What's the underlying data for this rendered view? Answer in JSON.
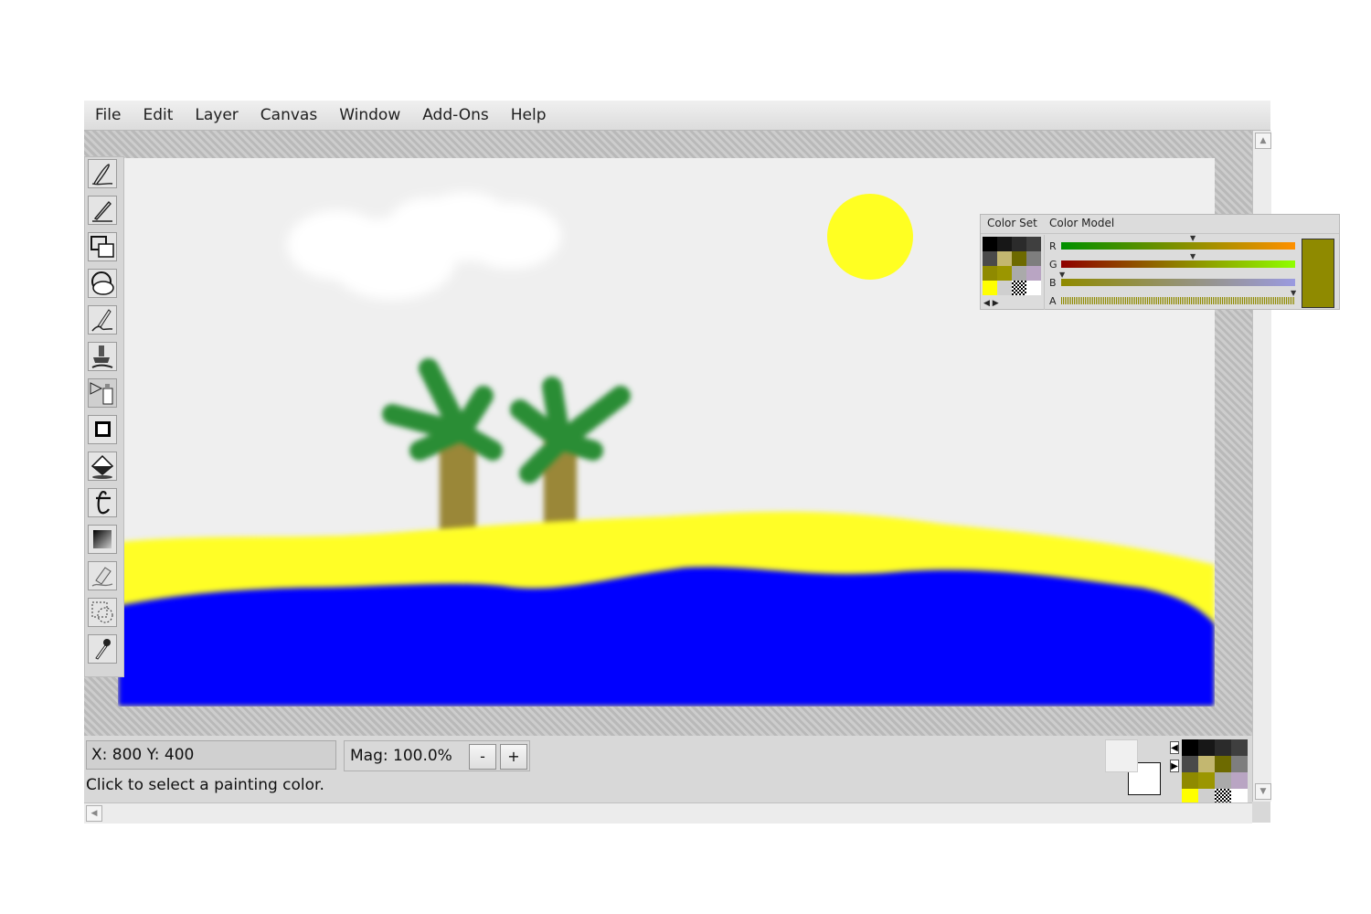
{
  "menu": [
    "File",
    "Edit",
    "Layer",
    "Canvas",
    "Window",
    "Add-Ons",
    "Help"
  ],
  "status": {
    "coords": "X: 800   Y: 400",
    "mag_label": "Mag: 100.0%",
    "zoom_out": "-",
    "zoom_in": "+",
    "hint": "Click to select a painting color."
  },
  "palette": {
    "tab_set": "Color Set",
    "tab_model": "Color Model",
    "labels": [
      "R",
      "G",
      "B",
      "A"
    ],
    "current_color": "#8f8a00",
    "swatches": [
      "#000000",
      "#171717",
      "#2b2b2b",
      "#3f3f3f",
      "#4a4a4a",
      "#c3b770",
      "#6d6a00",
      "#7e7e7e",
      "#8f8a00",
      "#9b9600",
      "#aaaaaa",
      "#b9a5c3",
      "#ffff00",
      "#cfcfcf",
      "checker",
      "#ffffff"
    ]
  },
  "colors": {
    "sky": "#efefef",
    "sun": "#ffff22",
    "sand": "#fffe27",
    "sea": "#0000ff",
    "leaves": "#2b8d35",
    "trunk": "#9a8738",
    "primary": "#f0f0f0",
    "secondary": "#ffffff"
  },
  "tools": [
    "freehand-tool",
    "line-tool",
    "rectangle-tool",
    "ellipse-tool",
    "brush-tool",
    "airbrush-tool",
    "bucket-spray-tool",
    "blur-tool",
    "fill-tool",
    "text-tool",
    "gradient-tool",
    "eraser-tool",
    "selection-tool",
    "eyedropper-tool"
  ]
}
